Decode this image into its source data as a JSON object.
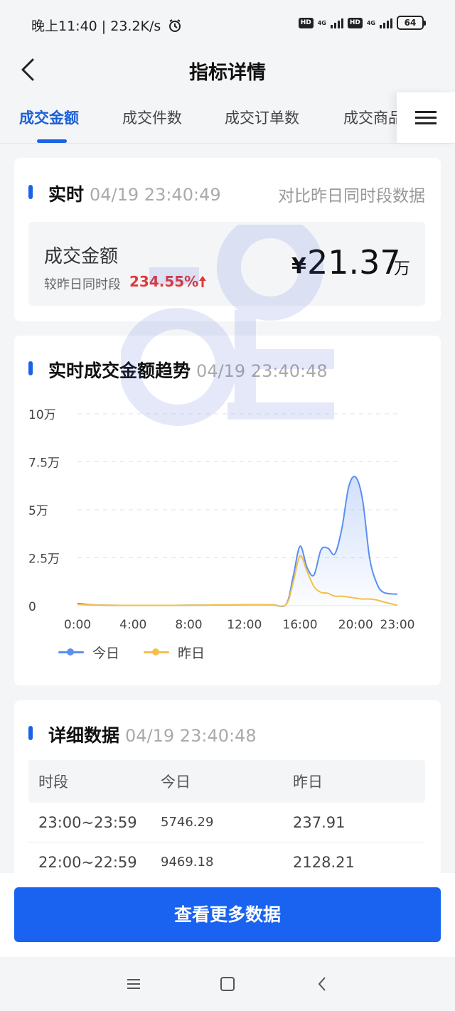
{
  "status": {
    "time_speed": "晚上11:40 | 23.2K/s",
    "hd1": "HD",
    "net1": "4G",
    "hd2": "HD",
    "net2": "4G",
    "battery": "64"
  },
  "nav": {
    "title": "指标详情"
  },
  "tabs": [
    "成交金额",
    "成交件数",
    "成交订单数",
    "成交商品"
  ],
  "realtime": {
    "title": "实时",
    "time": "04/19 23:40:49",
    "compare": "对比昨日同时段数据",
    "metric_name": "成交金额",
    "sub_label": "较昨日同时段",
    "change_pct": "234.55%",
    "currency": "¥",
    "value": "21.37",
    "unit": "万"
  },
  "trend": {
    "title": "实时成交金额趋势",
    "time": "04/19 23:40:48",
    "legend_today": "今日",
    "legend_yesterday": "昨日"
  },
  "chart_data": {
    "type": "line",
    "title": "实时成交金额趋势",
    "x": [
      0,
      1,
      2,
      3,
      4,
      5,
      6,
      7,
      8,
      9,
      10,
      11,
      12,
      13,
      14,
      15,
      15.5,
      16,
      16.5,
      17,
      17.5,
      18,
      18.5,
      19,
      19.5,
      20,
      20.5,
      21,
      21.5,
      22,
      23
    ],
    "x_tick_labels": [
      "0:00",
      "4:00",
      "8:00",
      "12:00",
      "16:00",
      "20:00",
      "23:00"
    ],
    "x_ticks": [
      0,
      4,
      8,
      12,
      16,
      20,
      23
    ],
    "y_tick_labels": [
      "0",
      "2.5万",
      "5万",
      "7.5万",
      "10万"
    ],
    "ylim": [
      0,
      100000
    ],
    "series": [
      {
        "name": "今日",
        "color": "#5b8ff0",
        "values": [
          1200,
          500,
          300,
          200,
          200,
          200,
          200,
          200,
          300,
          300,
          400,
          400,
          500,
          500,
          500,
          800,
          15000,
          31000,
          20000,
          16000,
          29000,
          30000,
          27000,
          40000,
          62000,
          67000,
          55000,
          25000,
          12000,
          7000,
          6000
        ]
      },
      {
        "name": "昨日",
        "color": "#f5c04a",
        "values": [
          800,
          400,
          300,
          200,
          200,
          200,
          200,
          200,
          300,
          300,
          400,
          400,
          500,
          500,
          500,
          700,
          12000,
          26000,
          18000,
          10000,
          7000,
          6500,
          5000,
          5000,
          4500,
          4000,
          3500,
          3500,
          3000,
          2000,
          200
        ]
      }
    ],
    "grid": true,
    "legend": "bottom-left"
  },
  "detail": {
    "title": "详细数据",
    "time": "04/19 23:40:48",
    "headers": [
      "时段",
      "今日",
      "昨日"
    ],
    "rows": [
      [
        "23:00~23:59",
        "5746.29",
        "237.91"
      ],
      [
        "22:00~22:59",
        "9469.18",
        "2128.21"
      ]
    ]
  },
  "cta": {
    "label": "查看更多数据"
  }
}
